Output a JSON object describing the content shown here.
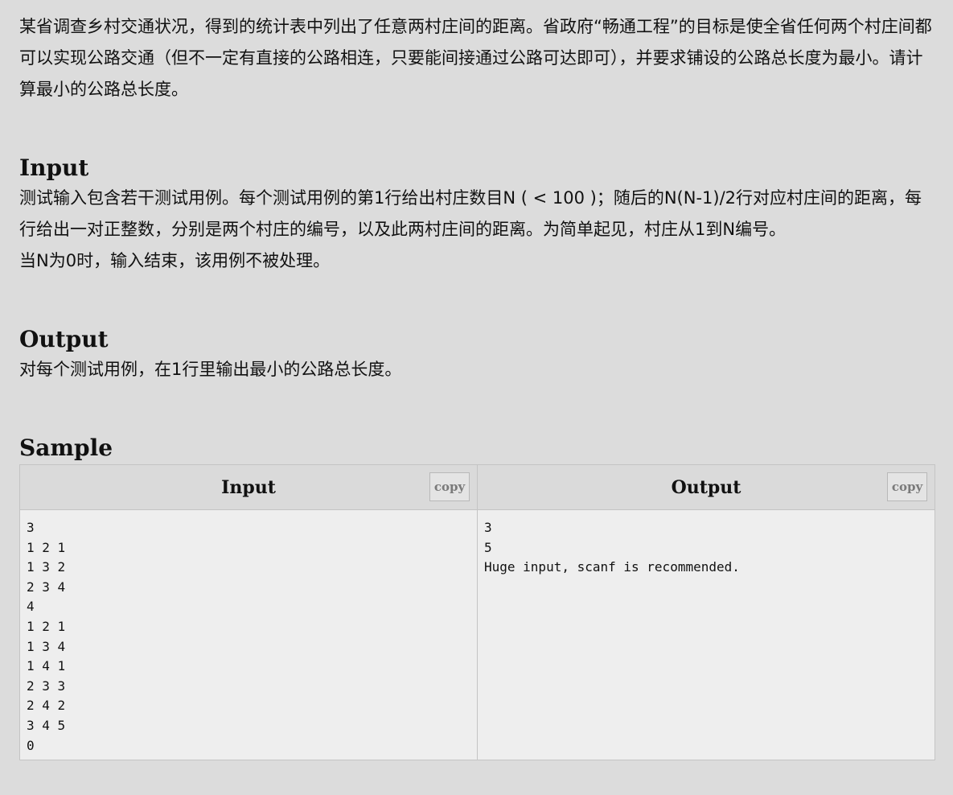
{
  "description": "某省调查乡村交通状况，得到的统计表中列出了任意两村庄间的距离。省政府“畅通工程”的目标是使全省任何两个村庄间都可以实现公路交通（但不一定有直接的公路相连，只要能间接通过公路可达即可），并要求铺设的公路总长度为最小。请计算最小的公路总长度。",
  "input_section": {
    "title": "Input",
    "text": "测试输入包含若干测试用例。每个测试用例的第1行给出村庄数目N ( < 100 )；随后的N(N-1)/2行对应村庄间的距离，每行给出一对正整数，分别是两个村庄的编号，以及此两村庄间的距离。为简单起见，村庄从1到N编号。\n当N为0时，输入结束，该用例不被处理。"
  },
  "output_section": {
    "title": "Output",
    "text": "对每个测试用例，在1行里输出最小的公路总长度。"
  },
  "sample": {
    "title": "Sample",
    "input_header": "Input",
    "output_header": "Output",
    "copy_label": "copy",
    "input_lines": [
      "3",
      "1 2 1",
      "1 3 2",
      "2 3 4",
      "4",
      "1 2 1",
      "1 3 4",
      "1 4 1",
      "2 3 3",
      "2 4 2",
      "3 4 5",
      "0"
    ],
    "output_lines": [
      "3",
      "5",
      "Huge input, scanf is recommended."
    ]
  }
}
